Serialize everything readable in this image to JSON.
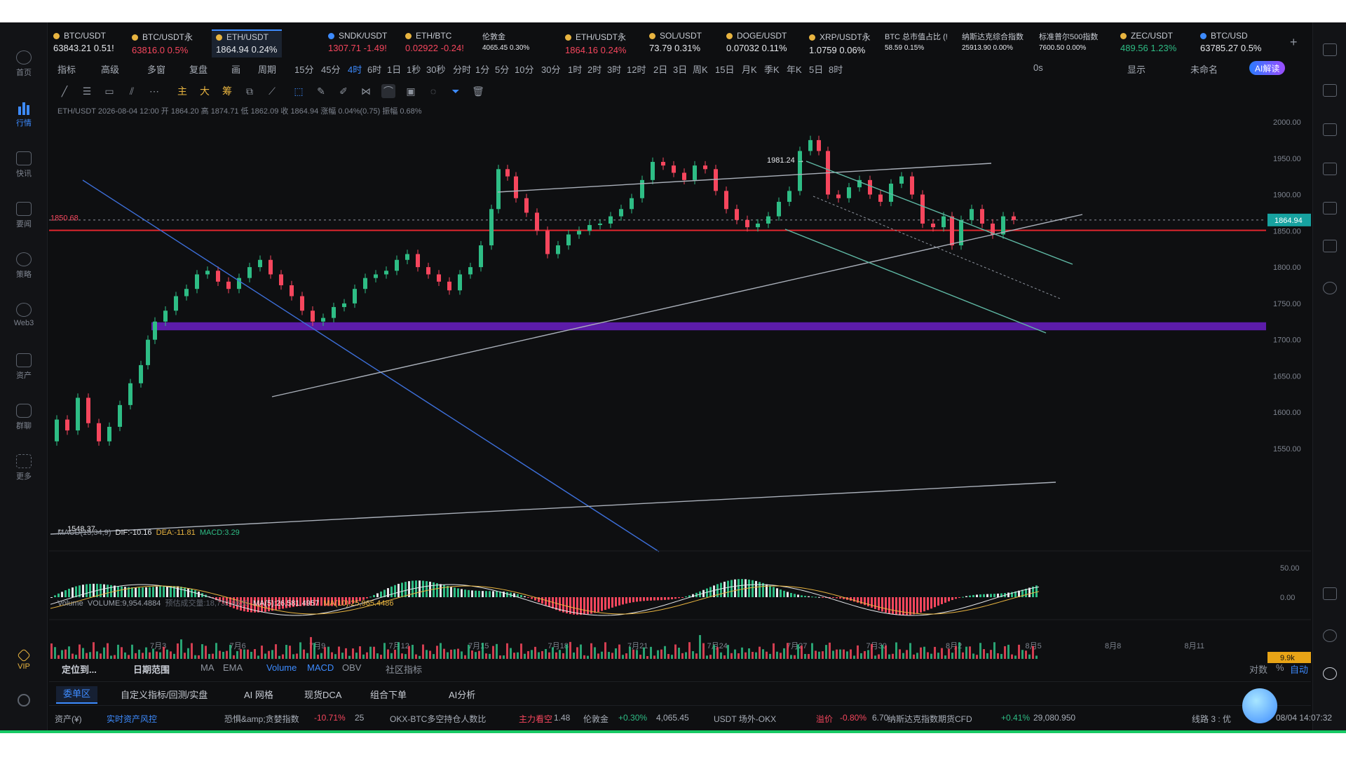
{
  "nav": {
    "items": [
      {
        "label": "首页"
      },
      {
        "label": "行情"
      },
      {
        "label": "快讯"
      },
      {
        "label": "要闻"
      },
      {
        "label": "策略"
      },
      {
        "label": "Web3"
      },
      {
        "label": "资产"
      },
      {
        "label": "群聊"
      },
      {
        "label": "更多"
      },
      {
        "label": "VIP"
      }
    ]
  },
  "tickers": [
    {
      "name": "BTC/USDT",
      "price": "63843.21",
      "change": "0.51!",
      "dir": "up",
      "dot": "#e8b440"
    },
    {
      "name": "BTC/USDT永",
      "price": "63816.0",
      "change": "0.5%",
      "dir": "dn",
      "dot": "#e8b440"
    },
    {
      "name": "ETH/USDT",
      "price": "1864.94",
      "change": "0.24%",
      "dir": "up",
      "dot": "#e8b440"
    },
    {
      "name": "SNDK/USDT",
      "price": "1307.71",
      "change": "-1.49!",
      "dir": "dn",
      "dot": "#3d8bff"
    },
    {
      "name": "ETH/BTC",
      "price": "0.02922",
      "change": "-0.24!",
      "dir": "dn",
      "dot": "#e8b440"
    },
    {
      "name": "伦敦金",
      "price": "4065.45",
      "change": "0.30%",
      "dir": "up",
      "dot": ""
    },
    {
      "name": "ETH/USDT永",
      "price": "1864.16",
      "change": "0.24%",
      "dir": "dn",
      "dot": "#e8b440"
    },
    {
      "name": "SOL/USDT",
      "price": "73.79",
      "change": "0.31%",
      "dir": "up",
      "dot": "#e8b440"
    },
    {
      "name": "DOGE/USDT",
      "price": "0.07032",
      "change": "0.11%",
      "dir": "up",
      "dot": "#e8b440"
    },
    {
      "name": "XRP/USDT永",
      "price": "1.0759",
      "change": "0.06%",
      "dir": "up",
      "dot": "#e8b440"
    },
    {
      "name": "BTC 总市值占比 (!",
      "price": "58.59",
      "change": "0.15%",
      "dir": "up",
      "dot": ""
    },
    {
      "name": "纳斯达克综合指数",
      "price": "25913.90",
      "change": "0.00%",
      "dir": "up",
      "dot": ""
    },
    {
      "name": "标准普尔500指数",
      "price": "7600.50",
      "change": "0.00%",
      "dir": "up",
      "dot": ""
    },
    {
      "name": "ZEC/USDT",
      "price": "489.56",
      "change": "1.23%",
      "dir": "up",
      "dot": "#e8b440"
    },
    {
      "name": "BTC/USD",
      "price": "63785.27",
      "change": "0.5%",
      "dir": "up",
      "dot": "#3d8bff"
    }
  ],
  "intervals": {
    "left": [
      "指标",
      "高级",
      "多窗",
      "复盘",
      "画",
      "周期"
    ],
    "list": [
      "15分",
      "45分",
      "4时",
      "6时",
      "1日",
      "1秒",
      "30秒",
      "分时",
      "1分",
      "5分",
      "10分",
      "30分",
      "1时",
      "2时",
      "3时",
      "12时",
      "2日",
      "3日",
      "周K",
      "15日",
      "月K",
      "季K",
      "年K",
      "5日",
      "8时"
    ],
    "selected": "4时",
    "right": [
      "0s",
      "显示",
      "未命名"
    ],
    "ai_label": "AI解读"
  },
  "chart": {
    "info": "ETH/USDT  2026-08-04 12:00  开 1864.20  高 1874.71  低 1862.09  收 1864.94  涨幅 0.04%(0.75)  振幅 0.68%",
    "high_label": "1981.24",
    "low_label": "1548.37",
    "price_line_label": "1850.68",
    "current_price": "1864.94",
    "y_ticks": [
      "2000.00",
      "1950.00",
      "1900.00",
      "1850.00",
      "1800.00",
      "1750.00",
      "1700.00",
      "1650.00",
      "1600.00",
      "1550.00"
    ],
    "x_ticks": [
      "7月3",
      "7月6",
      "7月9",
      "7月12",
      "7月15",
      "7月18",
      "7月21",
      "7月24",
      "7月27",
      "7月30",
      "8月2",
      "8月5",
      "8月8",
      "8月11"
    ]
  },
  "macd": {
    "label": "MACD(13,34,9)",
    "dif": "DIF:-10.16",
    "dea": "DEA:-11.81",
    "macd": "MACD:3.29",
    "y_ticks": [
      "50.00",
      "0.00"
    ]
  },
  "volume": {
    "label": "Volume",
    "vol": "VOLUME:9,954.4884",
    "pred": "预估成交量:18,732.9630",
    "ma5": "MA(5):26,581.4957",
    "ma10": "MA(10):25,965.4486",
    "tag": "9.9k"
  },
  "indicator_tabs": [
    "定位到...",
    "日期范围",
    "MA",
    "EMA",
    "Volume",
    "MACD",
    "OBV",
    "社区指标",
    "对数",
    "%",
    "自动"
  ],
  "panel_tabs": [
    "委单区",
    "自定义指标/回测/实盘",
    "AI 网格",
    "现货DCA",
    "组合下单",
    "AI分析"
  ],
  "status": {
    "items": [
      "资产(¥)",
      "实时资产风控",
      "恐惧&amp;贪婪指数",
      "-10.71%",
      "25",
      "OKX-BTC多空持仓人数比",
      "主力看空",
      "1.48",
      "伦敦金",
      "+0.30%",
      "4,065.45",
      "USDT 场外-OKX",
      "溢价",
      "-0.80%",
      "6.70",
      "纳斯达克指数期货CFD",
      "+0.41%",
      "29,080.950",
      "线路 3 : 优",
      "08/04 14:07:32"
    ]
  },
  "colors": {
    "up": "#2ebd85",
    "down": "#f6465d",
    "accent": "#3d8bff",
    "purple_zone": "#6a1fc4",
    "red_line": "#e0262e"
  }
}
